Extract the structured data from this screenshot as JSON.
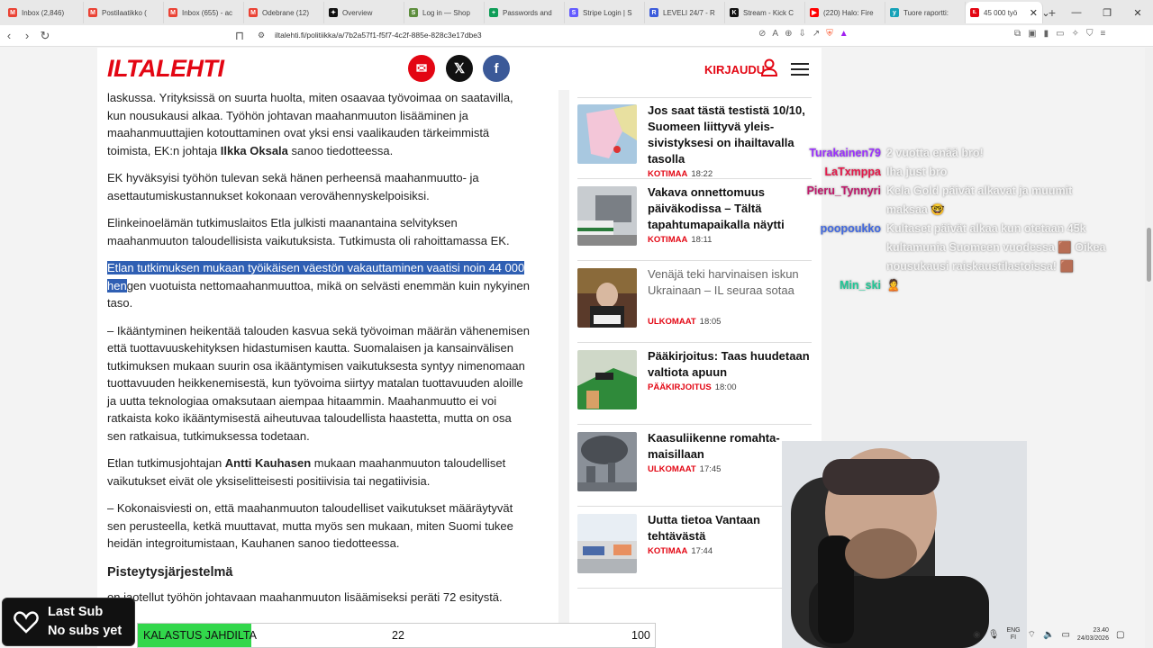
{
  "browser": {
    "tabs": [
      {
        "title": "Inbox (2,846)",
        "icon": "gmail-icon",
        "color": "#ea4335",
        "glyph": "M"
      },
      {
        "title": "Postilaatikko (",
        "icon": "gmail-icon",
        "color": "#ea4335",
        "glyph": "M"
      },
      {
        "title": "Inbox (655) - ac",
        "icon": "gmail-icon",
        "color": "#ea4335",
        "glyph": "M"
      },
      {
        "title": "Odebrane (12)",
        "icon": "gmail-icon",
        "color": "#ea4335",
        "glyph": "M"
      },
      {
        "title": "Overview",
        "icon": "app-icon",
        "color": "#111111",
        "glyph": "✦"
      },
      {
        "title": "Log in — Shop",
        "icon": "shopify-icon",
        "color": "#5e8e3e",
        "glyph": "S"
      },
      {
        "title": "Passwords and",
        "icon": "sheets-icon",
        "color": "#0f9d58",
        "glyph": "+"
      },
      {
        "title": "Stripe Login | S",
        "icon": "stripe-icon",
        "color": "#635bff",
        "glyph": "S"
      },
      {
        "title": "LEVELI 24/7 - R",
        "icon": "r-icon",
        "color": "#3b5bdb",
        "glyph": "R"
      },
      {
        "title": "Stream - Kick C",
        "icon": "kick-icon",
        "color": "#111111",
        "glyph": "K"
      },
      {
        "title": "(220) Halo: Fire",
        "icon": "youtube-icon",
        "color": "#ff0000",
        "glyph": "▶"
      },
      {
        "title": "Tuore raportti:",
        "icon": "yle-icon",
        "color": "#17a2b8",
        "glyph": "y"
      }
    ],
    "active_tab": {
      "title": "45 000 työ",
      "icon": "iltalehti-icon",
      "color": "#e30613",
      "glyph": "IL"
    },
    "url": "iltalehti.fi/politiikka/a/7b2a57f1-f5f7-4c2f-885e-828c3e17dbe3"
  },
  "site": {
    "logo": "ILTALEHTI",
    "login": "KIRJAUDU"
  },
  "article": {
    "p1": "laskussa. Yrityksissä on suurta huolta, miten osaavaa työvoimaa on saatavilla, kun nousukausi alkaa. Työhön johtavan maahanmuuton lisääminen ja maahanmuuttajien kotouttaminen ovat yksi ensi vaalikauden tärkeimmistä toimista, EK:n johtaja ",
    "p1_bold": "Ilkka Oksala",
    "p1_end": " sanoo tiedotteessa.",
    "p2": "EK hyväksyisi työhön tulevan sekä hänen perheensä maahanmuutto- ja asettautumiskustannukset kokonaan verovähennyskelpoisiksi.",
    "p3": "Elinkeinoelämän tutkimuslaitos Etla julkisti maanantaina selvityksen maahanmuuton taloudellisista vaikutuksista. Tutkimusta oli rahoittamassa EK.",
    "p4_selected": "Etlan tutkimuksen mukaan työikäisen väestön vakauttaminen vaatisi noin 44 000 hen",
    "p4_rest": "gen vuotuista nettomaahanmuuttoa, mikä on selvästi enemmän kuin nykyinen taso.",
    "p5": "– Ikääntyminen heikentää talouden kasvua sekä työvoiman määrän vähenemisen että tuottavuuskehityksen hidastumisen kautta. Suomalaisen ja kansainvälisen tutkimuksen mukaan suurin osa ikääntymisen vaikutuksesta syntyy nimenomaan tuottavuuden heikkenemisestä, kun työvoima siirtyy matalan tuottavuuden aloille ja uutta teknologiaa omaksutaan aiempaa hitaammin. Maahanmuutto ei voi ratkaista koko ikääntymisestä aiheutuvaa taloudellista haastetta, mutta on osa sen ratkaisua, tutkimuksessa todetaan.",
    "p6_start": "Etlan tutkimusjohtajan ",
    "p6_bold": "Antti Kauhasen",
    "p6_end": " mukaan maahanmuuton taloudelliset vaikutukset eivät ole yksiselitteisesti positiivisia tai negatiivisia.",
    "p7": "– Kokonaisviesti on, että maahanmuuton taloudelliset vaikutukset määräytyvät sen perusteella, ketkä muuttavat, mutta myös sen mukaan, miten Suomi tukee heidän integroitumistaan, Kauhanen sanoo tiedotteessa.",
    "subheading": "Pisteytysjärjestelmä",
    "p8": "on jaotellut työhön johtavaan maahanmuuton lisäämiseksi peräti 72 esitystä."
  },
  "sidebar": {
    "news": [
      {
        "title": "Jos saat tästä testistä 10/10, Suomeen liittyvä yleis-sivistyksesi on ihailtavalla tasolla",
        "category": "KOTIMAA",
        "time": "18:22",
        "read": false
      },
      {
        "title": "Vakava onnettomuus päiväkodissa – Tältä tapahtumapaikalla näytti",
        "category": "KOTIMAA",
        "time": "18:11",
        "read": false
      },
      {
        "title": "Venäjä teki harvinaisen iskun Ukrainaan – IL seuraa sotaa",
        "category": "ULKOMAAT",
        "time": "18:05",
        "read": true
      },
      {
        "title": "Pääkirjoitus: Taas huudetaan valtiota apuun",
        "category": "PÄÄKIRJOITUS",
        "time": "18:00",
        "read": false
      },
      {
        "title": "Kaasuliikenne romahta-maisillaan",
        "category": "ULKOMAAT",
        "time": "17:45",
        "read": false
      },
      {
        "title": "Uutta tietoa Vantaan tehtävästä",
        "category": "KOTIMAA",
        "time": "17:44",
        "read": false
      }
    ]
  },
  "chat": [
    {
      "user": "Turakainen79",
      "color": "#9b30ff",
      "msg": "2 vuotta enää bro!"
    },
    {
      "user": "LaTxmppa",
      "color": "#e6194b",
      "msg": "Iha just bro"
    },
    {
      "user": "Pieru_Tynnyri",
      "color": "#c0186b",
      "msg": "Kela Gold päivät alkavat ja muumit maksaa 🤓"
    },
    {
      "user": "poopoukko",
      "color": "#4169e1",
      "msg": "Kultaset päivät alkaa kun otetaan 45k kultamunia Suomeen vuodessa 🟫 Oikea nousukausi raiskaustilastoissa! 🟫"
    },
    {
      "user": "Min_ski",
      "color": "#20c997",
      "msg": "🙎"
    }
  ],
  "overlay": {
    "sub_line1": "Last Sub",
    "sub_line2": "No subs yet",
    "goal_label": "KALASTUS JAHDILTA",
    "goal_current": "22",
    "goal_max": "100",
    "goal_fraction": 0.22
  },
  "taskbar": {
    "lang": "ENG",
    "region": "FI",
    "time": "23.40",
    "date": "24/03/2026"
  }
}
